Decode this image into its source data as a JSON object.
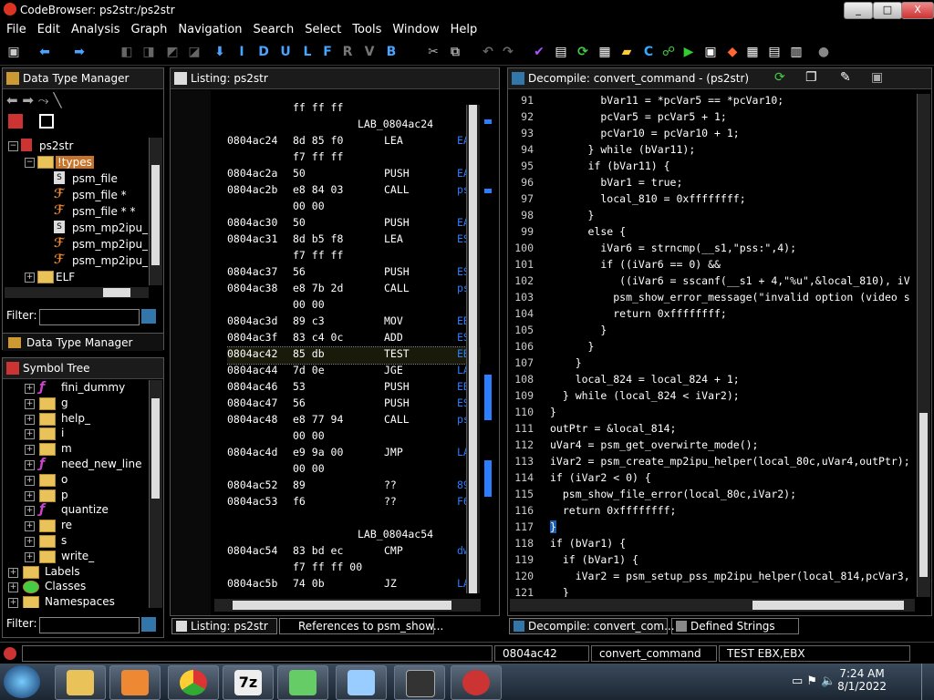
{
  "window": {
    "title": "CodeBrowser: ps2str:/ps2str",
    "min": "_",
    "max": "□",
    "close": "X"
  },
  "menu": [
    "File",
    "Edit",
    "Analysis",
    "Graph",
    "Navigation",
    "Search",
    "Select",
    "Tools",
    "Window",
    "Help"
  ],
  "toolbar_letters": [
    "I",
    "D",
    "U",
    "L",
    "F",
    "R",
    "V",
    "B"
  ],
  "dtm": {
    "title": "Data Type Manager",
    "root": "ps2str",
    "items": [
      {
        "label": "!types",
        "kind": "folder",
        "level": 1
      },
      {
        "label": "psm_file",
        "kind": "file",
        "level": 2
      },
      {
        "label": "psm_file *",
        "kind": "ptr",
        "level": 2
      },
      {
        "label": "psm_file * *",
        "kind": "ptr",
        "level": 2
      },
      {
        "label": "psm_mp2ipu_h",
        "kind": "file",
        "level": 2
      },
      {
        "label": "psm_mp2ipu_h",
        "kind": "ptr",
        "level": 2
      },
      {
        "label": "psm_mp2ipu_h",
        "kind": "ptr",
        "level": 2
      },
      {
        "label": "ELF",
        "kind": "folder",
        "level": 1
      }
    ],
    "filter_label": "Filter:",
    "tab_label": "Data Type Manager"
  },
  "symtree": {
    "title": "Symbol Tree",
    "items": [
      {
        "label": "fini_dummy",
        "kind": "func",
        "level": 2
      },
      {
        "label": "g",
        "kind": "folder",
        "level": 2
      },
      {
        "label": "help_",
        "kind": "folder",
        "level": 2
      },
      {
        "label": "i",
        "kind": "folder",
        "level": 2
      },
      {
        "label": "m",
        "kind": "folder",
        "level": 2
      },
      {
        "label": "need_new_line",
        "kind": "func",
        "level": 2
      },
      {
        "label": "o",
        "kind": "folder",
        "level": 2
      },
      {
        "label": "p",
        "kind": "folder",
        "level": 2
      },
      {
        "label": "quantize",
        "kind": "func",
        "level": 2
      },
      {
        "label": "re",
        "kind": "folder",
        "level": 2
      },
      {
        "label": "s",
        "kind": "folder",
        "level": 2
      },
      {
        "label": "write_",
        "kind": "folder",
        "level": 2
      },
      {
        "label": "Labels",
        "kind": "folder",
        "level": 1
      },
      {
        "label": "Classes",
        "kind": "class",
        "level": 1
      },
      {
        "label": "Namespaces",
        "kind": "folder",
        "level": 1
      }
    ],
    "filter_label": "Filter:"
  },
  "listing": {
    "title": "Listing:  ps2str",
    "rows": [
      {
        "type": "cont",
        "bytes": "ff ff ff"
      },
      {
        "type": "label",
        "text": "LAB_0804ac24"
      },
      {
        "type": "ins",
        "addr": "0804ac24",
        "bytes": "8d 85 f0",
        "mn": "LEA",
        "op": "EAX"
      },
      {
        "type": "cont",
        "bytes": "f7 ff ff"
      },
      {
        "type": "ins",
        "addr": "0804ac2a",
        "bytes": "50",
        "mn": "PUSH",
        "op": "EAX"
      },
      {
        "type": "ins",
        "addr": "0804ac2b",
        "bytes": "e8 84 03",
        "mn": "CALL",
        "op": "ps"
      },
      {
        "type": "cont",
        "bytes": "00 00"
      },
      {
        "type": "ins",
        "addr": "0804ac30",
        "bytes": "50",
        "mn": "PUSH",
        "op": "EAX"
      },
      {
        "type": "ins",
        "addr": "0804ac31",
        "bytes": "8d b5 f8",
        "mn": "LEA",
        "op": "ESI"
      },
      {
        "type": "cont",
        "bytes": "f7 ff ff"
      },
      {
        "type": "ins",
        "addr": "0804ac37",
        "bytes": "56",
        "mn": "PUSH",
        "op": "ESI"
      },
      {
        "type": "ins",
        "addr": "0804ac38",
        "bytes": "e8 7b 2d",
        "mn": "CALL",
        "op": "ps"
      },
      {
        "type": "cont",
        "bytes": "00 00"
      },
      {
        "type": "ins",
        "addr": "0804ac3d",
        "bytes": "89 c3",
        "mn": "MOV",
        "op": "EBX"
      },
      {
        "type": "ins",
        "addr": "0804ac3f",
        "bytes": "83 c4 0c",
        "mn": "ADD",
        "op": "ESP"
      },
      {
        "type": "ins",
        "addr": "0804ac42",
        "bytes": "85 db",
        "mn": "TEST",
        "op": "EBX"
      },
      {
        "type": "ins",
        "addr": "0804ac44",
        "bytes": "7d 0e",
        "mn": "JGE",
        "op": "LA"
      },
      {
        "type": "ins",
        "addr": "0804ac46",
        "bytes": "53",
        "mn": "PUSH",
        "op": "EBX"
      },
      {
        "type": "ins",
        "addr": "0804ac47",
        "bytes": "56",
        "mn": "PUSH",
        "op": "ESI"
      },
      {
        "type": "ins",
        "addr": "0804ac48",
        "bytes": "e8 77 94",
        "mn": "CALL",
        "op": "ps"
      },
      {
        "type": "cont",
        "bytes": "00 00"
      },
      {
        "type": "ins",
        "addr": "0804ac4d",
        "bytes": "e9 9a 00",
        "mn": "JMP",
        "op": "LA"
      },
      {
        "type": "cont",
        "bytes": "00 00"
      },
      {
        "type": "ins",
        "addr": "0804ac52",
        "bytes": "89",
        "mn": "??",
        "op": "89"
      },
      {
        "type": "ins",
        "addr": "0804ac53",
        "bytes": "f6",
        "mn": "??",
        "op": "F6"
      },
      {
        "type": "blank"
      },
      {
        "type": "label",
        "text": "LAB_0804ac54"
      },
      {
        "type": "ins",
        "addr": "0804ac54",
        "bytes": "83 bd ec",
        "mn": "CMP",
        "op": "dw"
      },
      {
        "type": "cont",
        "bytes": "f7 ff ff 00"
      },
      {
        "type": "ins",
        "addr": "0804ac5b",
        "bytes": "74 0b",
        "mn": "JZ",
        "op": "LA"
      }
    ]
  },
  "decompile": {
    "title": "Decompile: convert_command  -  (ps2str)",
    "lines": [
      {
        "n": "91",
        "code": "        bVar11 = *pcVar5 == *pcVar10;"
      },
      {
        "n": "92",
        "code": "        pcVar5 = pcVar5 + 1;"
      },
      {
        "n": "93",
        "code": "        pcVar10 = pcVar10 + 1;"
      },
      {
        "n": "94",
        "code": "      } while (bVar11);"
      },
      {
        "n": "95",
        "code": "      if (bVar11) {"
      },
      {
        "n": "96",
        "code": "        bVar1 = true;"
      },
      {
        "n": "97",
        "code": "        local_810 = 0xffffffff;"
      },
      {
        "n": "98",
        "code": "      }"
      },
      {
        "n": "99",
        "code": "      else {"
      },
      {
        "n": "100",
        "code": "        iVar6 = strncmp(__s1,\"pss:\",4);"
      },
      {
        "n": "101",
        "code": "        if ((iVar6 == 0) &&"
      },
      {
        "n": "102",
        "code": "           ((iVar6 = sscanf(__s1 + 4,\"%u\",&local_810), iV"
      },
      {
        "n": "103",
        "code": "          psm_show_error_message(\"invalid option (video s"
      },
      {
        "n": "104",
        "code": "          return 0xffffffff;"
      },
      {
        "n": "105",
        "code": "        }"
      },
      {
        "n": "106",
        "code": "      }"
      },
      {
        "n": "107",
        "code": "    }"
      },
      {
        "n": "108",
        "code": "    local_824 = local_824 + 1;"
      },
      {
        "n": "109",
        "code": "  } while (local_824 < iVar2);"
      },
      {
        "n": "110",
        "code": "}"
      },
      {
        "n": "111",
        "code": "outPtr = &local_814;"
      },
      {
        "n": "112",
        "code": "uVar4 = psm_get_overwirte_mode();"
      },
      {
        "n": "113",
        "code": "iVar2 = psm_create_mp2ipu_helper(local_80c,uVar4,outPtr);"
      },
      {
        "n": "114",
        "code": "if (iVar2 < 0) {"
      },
      {
        "n": "115",
        "code": "  psm_show_file_error(local_80c,iVar2);"
      },
      {
        "n": "116",
        "code": "  return 0xffffffff;"
      },
      {
        "n": "117",
        "code": "}"
      },
      {
        "n": "118",
        "code": "if (bVar1) {"
      },
      {
        "n": "119",
        "code": "  if (bVar1) {"
      },
      {
        "n": "120",
        "code": "    iVar2 = psm_setup_pss_mp2ipu_helper(local_814,pcVar3,"
      },
      {
        "n": "121",
        "code": "  }"
      }
    ]
  },
  "bottom_tabs": {
    "listing": "Listing:  ps2str",
    "references": "References to psm_show...",
    "decompile": "Decompile: convert_com...",
    "strings": "Defined Strings"
  },
  "status": {
    "address": "0804ac42",
    "function": "convert_command",
    "instruction": "TEST EBX,EBX"
  },
  "taskbar": {
    "time": "7:24 AM",
    "date": "8/1/2022"
  },
  "colors": {
    "accent": "#2b7fff",
    "folder": "#e9c35a",
    "func": "#cc44cc",
    "highlight": "#1a5fb4"
  }
}
